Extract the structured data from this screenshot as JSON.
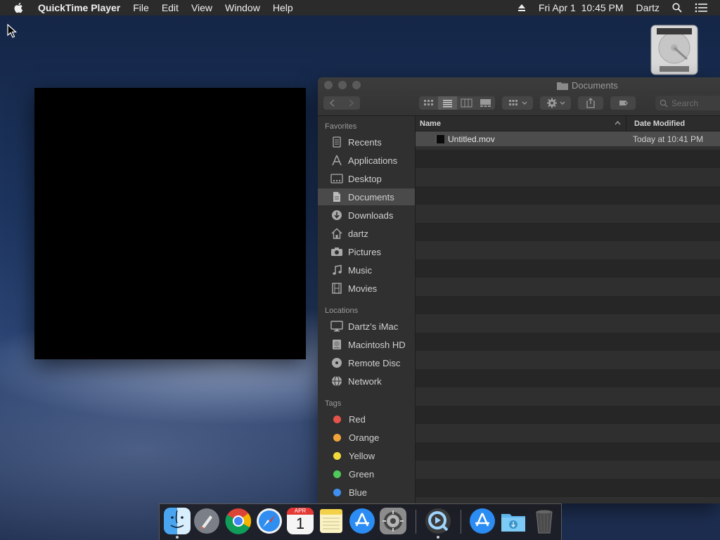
{
  "menubar": {
    "app_name": "QuickTime Player",
    "items": [
      "File",
      "Edit",
      "View",
      "Window",
      "Help"
    ],
    "clock": "Fri Apr 1  10:45 PM",
    "user": "Dartz"
  },
  "finder": {
    "title": "Documents",
    "search_placeholder": "Search",
    "sidebar": {
      "favorites_header": "Favorites",
      "favorites": [
        "Recents",
        "Applications",
        "Desktop",
        "Documents",
        "Downloads",
        "dartz",
        "Pictures",
        "Music",
        "Movies"
      ],
      "locations_header": "Locations",
      "locations": [
        "Dartz’s iMac",
        "Macintosh HD",
        "Remote Disc",
        "Network"
      ],
      "tags_header": "Tags",
      "tags": [
        {
          "label": "Red",
          "color": "#e5534b"
        },
        {
          "label": "Orange",
          "color": "#f0a43a"
        },
        {
          "label": "Yellow",
          "color": "#f2d83a"
        },
        {
          "label": "Green",
          "color": "#4fc95a"
        },
        {
          "label": "Blue",
          "color": "#3f8ff0"
        }
      ]
    },
    "list": {
      "columns": {
        "name": "Name",
        "date": "Date Modified"
      },
      "rows": [
        {
          "name": "Untitled.mov",
          "date": "Today at 10:41 PM"
        }
      ]
    }
  },
  "dock": {
    "apps": [
      "Finder",
      "Launchpad",
      "Chrome",
      "Safari",
      "Calendar",
      "Notes",
      "App Store",
      "System Preferences",
      "QuickTime Player",
      "Applications",
      "Downloads",
      "Trash"
    ],
    "calendar": {
      "month": "APR",
      "day": "1"
    }
  }
}
